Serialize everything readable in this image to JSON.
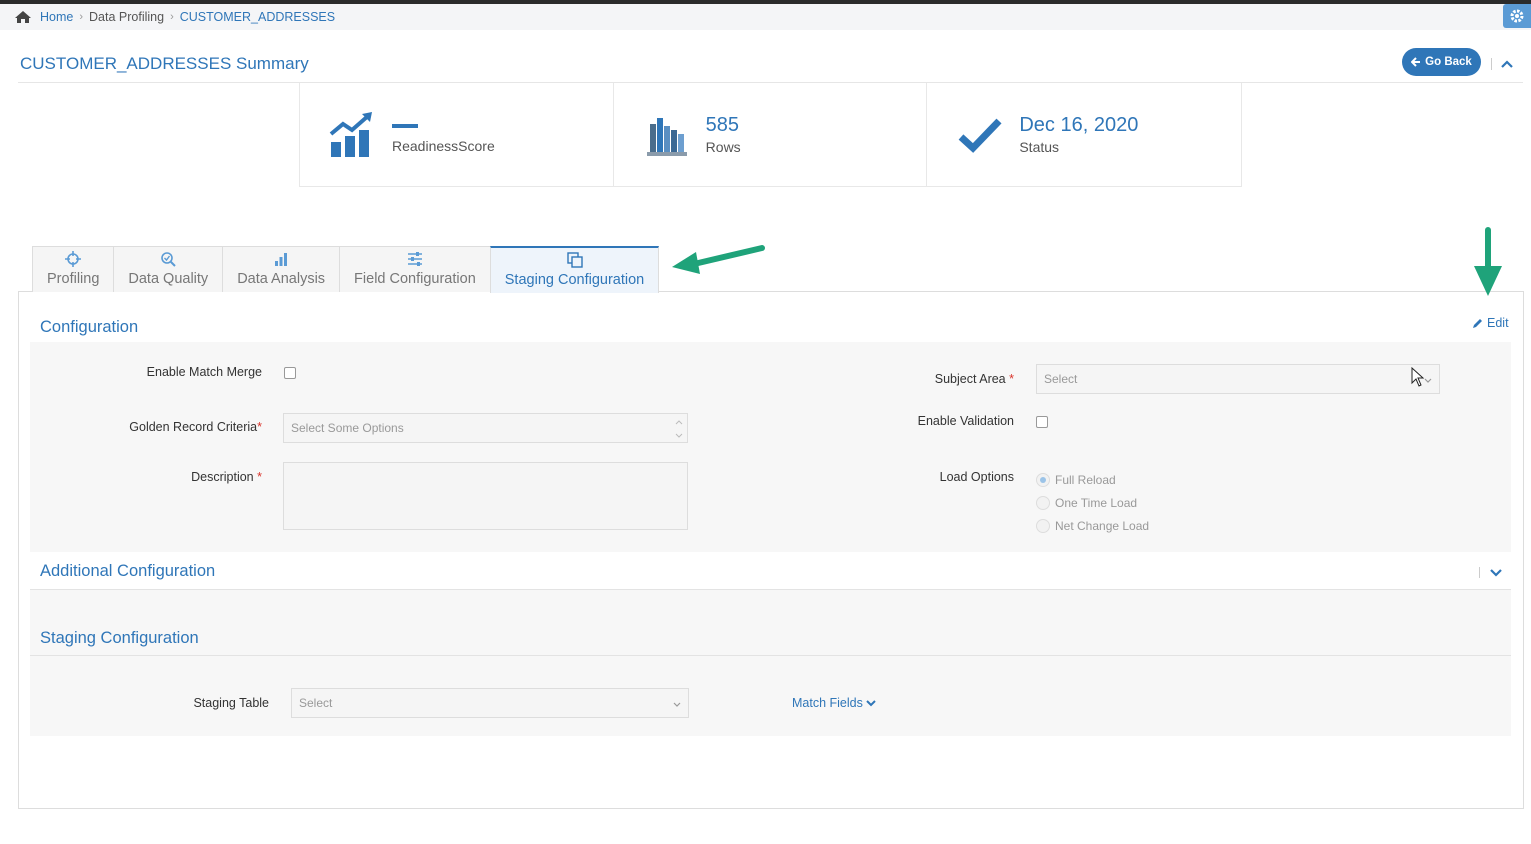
{
  "breadcrumb": {
    "home": "Home",
    "section": "Data Profiling",
    "current": "CUSTOMER_ADDRESSES"
  },
  "header": {
    "title": "CUSTOMER_ADDRESSES Summary",
    "go_back": "Go Back"
  },
  "stats": {
    "readiness": {
      "value": "",
      "label": "ReadinessScore"
    },
    "rows": {
      "value": "585",
      "label": "Rows"
    },
    "status": {
      "value": "Dec 16, 2020",
      "label": "Status"
    }
  },
  "tabs": [
    {
      "label": "Profiling",
      "icon": "crosshair-icon"
    },
    {
      "label": "Data Quality",
      "icon": "magnify-check-icon"
    },
    {
      "label": "Data Analysis",
      "icon": "stack-chart-icon"
    },
    {
      "label": "Field Configuration",
      "icon": "sliders-icon"
    },
    {
      "label": "Staging Configuration",
      "icon": "copy-icon",
      "active": true
    }
  ],
  "configuration": {
    "title": "Configuration",
    "edit": "Edit",
    "enable_match_merge": "Enable Match Merge",
    "golden_record_criteria": "Golden Record Criteria",
    "golden_record_placeholder": "Select Some Options",
    "description": "Description",
    "subject_area": "Subject Area",
    "subject_area_placeholder": "Select",
    "enable_validation": "Enable Validation",
    "load_options": "Load Options",
    "load_option_values": [
      "Full Reload",
      "One Time Load",
      "Net Change Load"
    ],
    "required_mark": "*"
  },
  "additional": {
    "title": "Additional Configuration"
  },
  "staging": {
    "title": "Staging Configuration",
    "staging_table": "Staging Table",
    "staging_table_placeholder": "Select",
    "match_fields": "Match Fields"
  },
  "colors": {
    "accent": "#2f76b8",
    "annotation_arrow": "#1fa37a",
    "required": "#d9342b"
  }
}
